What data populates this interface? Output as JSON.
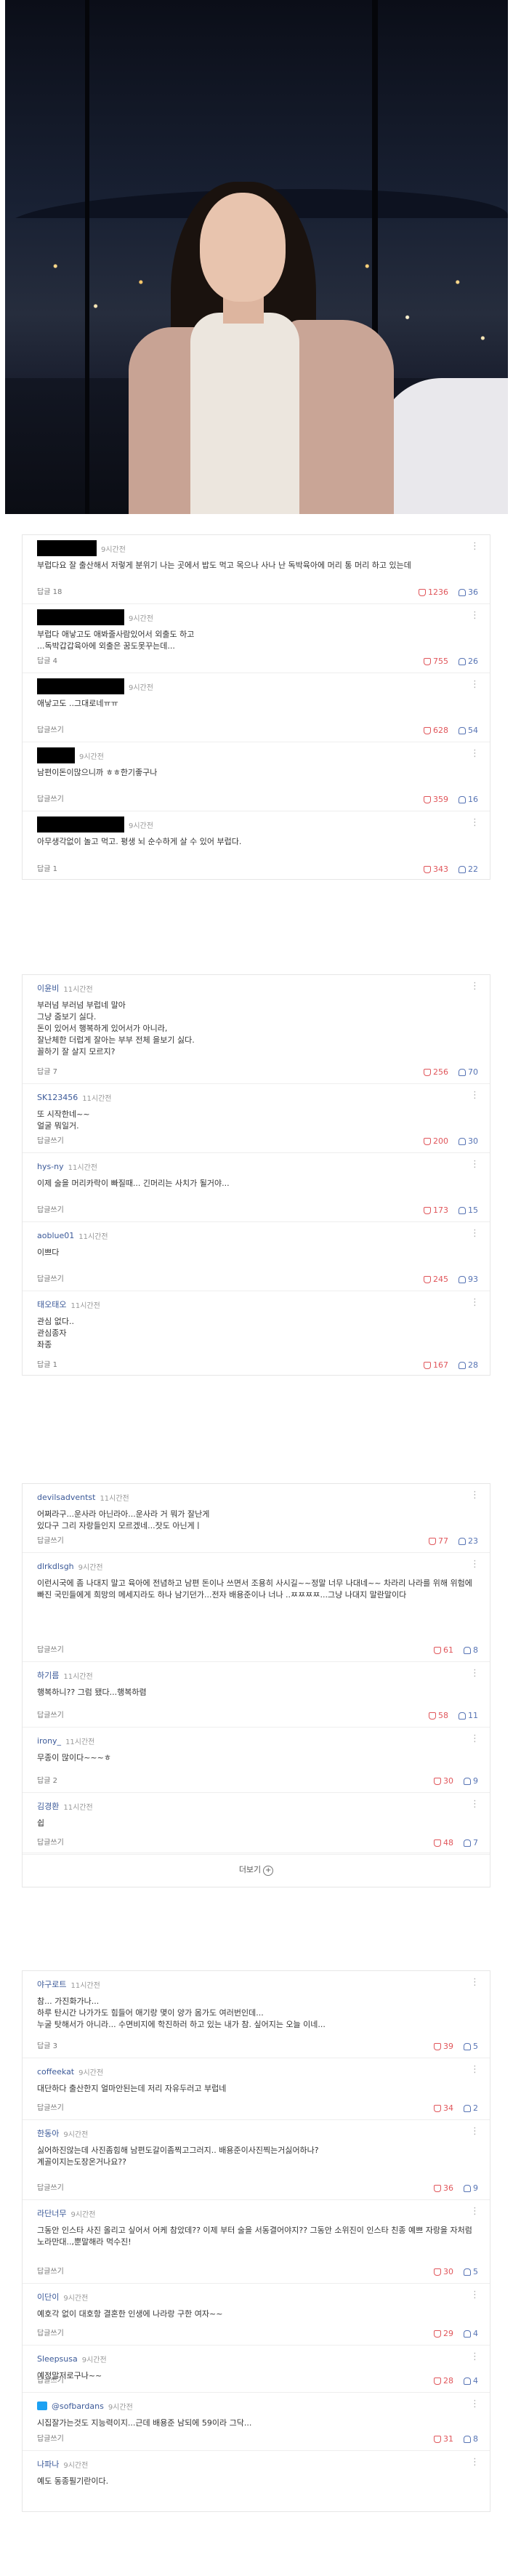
{
  "photo": {
    "alt": ""
  },
  "card1": {
    "comments": [
      {
        "nick": "",
        "time": "9시간전",
        "text": "부럽다요 잘 출산해서 저렇게 분위기 나는 곳에서 밥도 먹고 목으나 사나 난 독박육아에 머리 통 머리 하고 있는데",
        "reply": "답글 18",
        "up": "1236",
        "down": "36"
      },
      {
        "nick": "",
        "time": "9시간전",
        "text": "부럽다 애낳고도 애봐줄사람있어서 외출도 하고\n...독박갑갑육아에 외출은 꿈도못꾸는데...",
        "reply": "답글 4",
        "up": "755",
        "down": "26"
      },
      {
        "nick": "",
        "time": "9시간전",
        "text": "애낳고도 ..그대로네ㅠㅠ",
        "reply": "답글쓰기",
        "up": "628",
        "down": "54"
      },
      {
        "nick": "",
        "time": "9시간전",
        "text": "남편이돈이많으니까 ㅎㅎ한기좋구나",
        "reply": "답글쓰기",
        "up": "359",
        "down": "16"
      },
      {
        "nick": "",
        "time": "9시간전",
        "text": "아무생각없이 놀고 먹고. 평생 뇌 순수하게 살 수 있어 부럽다.",
        "reply": "답글 1",
        "up": "343",
        "down": "22"
      }
    ]
  },
  "card2": {
    "comments": [
      {
        "nick": "이윤비",
        "time": "11시간전",
        "text": "부러넘 부러넘 부럽네 말아\n그냥 줌보기 싫다.\n돈이 있어서 행복하게 있어서가 아니라,\n잘난체한 더럽게 잘아는 부부 전체 을보기 싫다.\n꼴하기 잘 살지 모르지?",
        "reply": "답글 7",
        "up": "256",
        "down": "70"
      },
      {
        "nick": "SK123456",
        "time": "11시간전",
        "text": "또 시작한네~~\n얼굴 뭐일거.",
        "reply": "답글쓰기",
        "up": "200",
        "down": "30"
      },
      {
        "nick": "hys-ny",
        "time": "11시간전",
        "text": "이제 술을 머리카락이 빠질때... 긴머리는 사치가 될거야...",
        "reply": "답글쓰기",
        "up": "173",
        "down": "15"
      },
      {
        "nick": "aoblue01",
        "time": "11시간전",
        "text": "이쁘다",
        "reply": "답글쓰기",
        "up": "245",
        "down": "93"
      },
      {
        "nick": "태오태오",
        "time": "11시간전",
        "text": "관심 없다..\n관심종자\n좌종",
        "reply": "답글 1",
        "up": "167",
        "down": "28"
      }
    ]
  },
  "card3": {
    "comments": [
      {
        "nick": "devilsadventst",
        "time": "11시간전",
        "text": "어쩌라구...운사라 아닌라아...운사라 거 뭐가 잘난게\n있다구 그리 자랑들인지 모르겠네...잣도 아닌게ㅣ",
        "reply": "답글쓰기",
        "up": "77",
        "down": "23"
      },
      {
        "nick": "dlrkdlsgh",
        "time": "9시간전",
        "text": "이런시국에 좀 나대지 말고 육아에 전념하고 남편 돈이나 쓰면서 조용히 사시길~~정말 너무 나대네~~ 차라리 나라를 위해 위험에 빠진 국민들에게 희망의 메세지라도 하나 남기던가...전자 배용준이나 너나 ..ㅉㅉㅉㅉ...그냥 나대지 말란말이다",
        "reply": "답글쓰기",
        "up": "61",
        "down": "8"
      },
      {
        "nick": "하기름",
        "time": "11시간전",
        "text": "행복하니?? 그럼 됐다...행복하렴",
        "reply": "답글쓰기",
        "up": "58",
        "down": "11"
      },
      {
        "nick": "irony_",
        "time": "11시간전",
        "text": "무종이 많이다~~~ㅎ",
        "reply": "답글 2",
        "up": "30",
        "down": "9"
      },
      {
        "nick": "김경환",
        "time": "11시간전",
        "text": "쉽",
        "reply": "답글쓰기",
        "up": "48",
        "down": "7"
      }
    ],
    "more_label": "더보기"
  },
  "card4": {
    "comments": [
      {
        "nick": "야구로트",
        "time": "11시간전",
        "text": "참... 가진화가나...\n하루 탄시간 나가가도 힘들어 애기랑 몇이 양가 몸가도 여러번인데...\n누굴 탓해서가 아니라... 수면비지에 학진하러 하고 있는 내가 참. 싶어지는 오늘 이네...",
        "reply": "답글 3",
        "up": "39",
        "down": "5"
      },
      {
        "nick": "coffeekat",
        "time": "9시간전",
        "text": "대단하다 출산한지 얼마안된는데 저리 자유두러고 부럽네",
        "reply": "답글쓰기",
        "up": "34",
        "down": "2"
      },
      {
        "nick": "한동아",
        "time": "9시간전",
        "text": "싫어하진않는데 사진좀힘해 남편도갈이좀찍고그러지.. 배용준이사진찍는거싫어하나?\n계골이지는도장온거나요??",
        "reply": "답글쓰기",
        "up": "36",
        "down": "9"
      },
      {
        "nick": "라단너무",
        "time": "9시간전",
        "text": "그동안 인스타 사진 올리고 싶어서 어케 참았데?? 이제 부터 술을 서동결어야지?? 그동안 소위진이 인스타 친종 예쁘 자랑을 자처럼 노라만대..,뿐말해라 먹수진!",
        "reply": "답글쓰기",
        "up": "30",
        "down": "5"
      },
      {
        "nick": "이단이",
        "time": "9시간전",
        "text": "예호각 없이 대호항 결혼한 인생에 나라랑 구한 여자~~",
        "reply": "답글쓰기",
        "up": "29",
        "down": "4"
      },
      {
        "nick": "Sleepsusa",
        "time": "9시간전",
        "text": "예정말저로구나~~",
        "reply": "답글쓰기",
        "up": "28",
        "down": "4"
      },
      {
        "nick": "@sofbardans",
        "time": "9시간전",
        "text": "시집잘가는것도 지능력이지...근데 배용준 남되에 59이라 그닥...",
        "reply": "답글쓰기",
        "up": "31",
        "down": "8"
      },
      {
        "nick": "나파나",
        "time": "9시간전",
        "text": "예도 동종필기란이다.",
        "reply": "",
        "up": "",
        "down": ""
      }
    ]
  }
}
